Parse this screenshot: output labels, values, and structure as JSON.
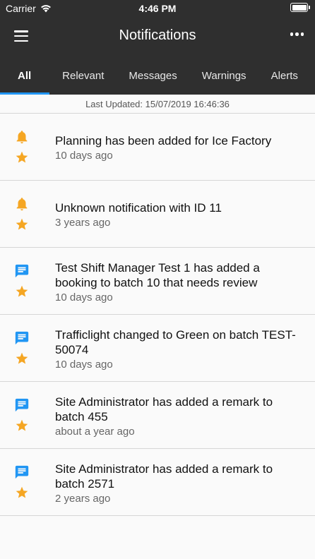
{
  "status_bar": {
    "carrier": "Carrier",
    "time": "4:46 PM"
  },
  "app_bar": {
    "title": "Notifications"
  },
  "tabs": [
    {
      "label": "All",
      "active": true
    },
    {
      "label": "Relevant",
      "active": false
    },
    {
      "label": "Messages",
      "active": false
    },
    {
      "label": "Warnings",
      "active": false
    },
    {
      "label": "Alerts",
      "active": false
    }
  ],
  "last_updated": "Last Updated: 15/07/2019 16:46:36",
  "colors": {
    "accent": "#2196f3",
    "header": "#2f2f2f",
    "icon_orange": "#f5a623",
    "icon_blue": "#2196f3"
  },
  "notifications": [
    {
      "icon": "bell-icon",
      "title": "Planning has been added for Ice Factory",
      "time": "10 days ago"
    },
    {
      "icon": "bell-icon",
      "title": "Unknown notification with ID 11",
      "time": "3 years ago"
    },
    {
      "icon": "message-icon",
      "title": "Test Shift Manager Test 1 has added a booking to batch 10 that needs review",
      "time": "10 days ago"
    },
    {
      "icon": "message-icon",
      "title": "Trafficlight changed to Green on batch TEST-50074",
      "time": "10 days ago"
    },
    {
      "icon": "message-icon",
      "title": "Site Administrator has added a remark to batch 455",
      "time": "about a year ago"
    },
    {
      "icon": "message-icon",
      "title": "Site Administrator has added a remark to batch 2571",
      "time": "2 years ago"
    }
  ]
}
